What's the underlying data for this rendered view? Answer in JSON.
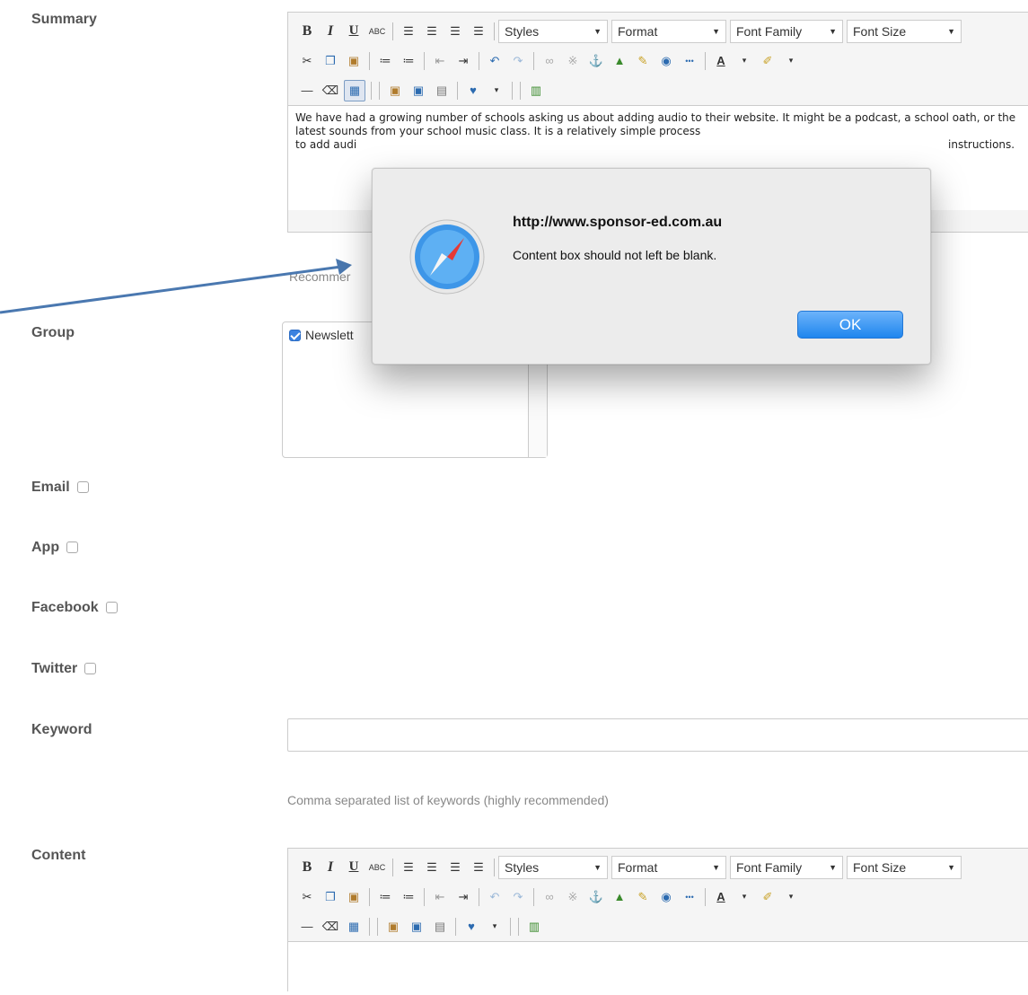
{
  "form": {
    "summary_label": "Summary",
    "group_label": "Group",
    "email_label": "Email",
    "app_label": "App",
    "facebook_label": "Facebook",
    "twitter_label": "Twitter",
    "keyword_label": "Keyword",
    "keyword_hint": "Comma separated list of keywords (highly recommended)",
    "content_label": "Content",
    "group_item_label": "Newslett",
    "recommend_partial": "Recommer",
    "summary_text": "We have had a growing number of schools asking us about adding audio to their website.  It might be a podcast, a school oath, or the latest sounds from your school music class.  It is a relatively simple process",
    "summary_text_line3_start": "to add audi",
    "summary_text_line3_end": "instructions."
  },
  "toolbar": {
    "bold": "B",
    "italic": "I",
    "underline": "U",
    "strike": "ABC",
    "styles": "Styles",
    "format": "Format",
    "font_family": "Font Family",
    "font_size": "Font Size"
  },
  "dialog": {
    "url": "http://www.sponsor-ed.com.au",
    "message": "Content box should not left be blank.",
    "ok_label": "OK"
  },
  "colors": {
    "accent": "#1f86ee",
    "arrow": "#4a78b0"
  }
}
